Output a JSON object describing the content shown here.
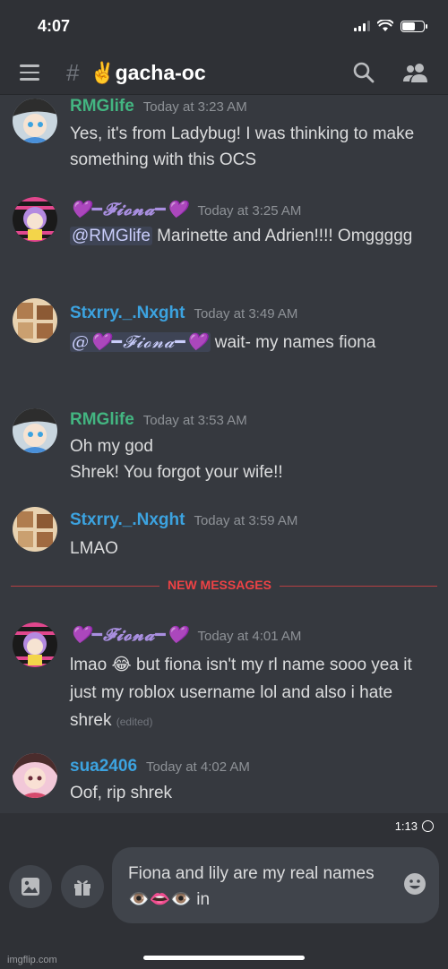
{
  "status_bar": {
    "time": "4:07"
  },
  "header": {
    "hash": "#",
    "channel": "✌️gacha-oc"
  },
  "messages": [
    {
      "author": "RMGlife",
      "author_color": "#43b581",
      "time": "Today at 3:23 AM",
      "text": "Yes, it's from Ladybug! I was thinking to make something with this OCS"
    },
    {
      "author": "💜━𝓕𝓲𝓸𝓷𝓪━💜",
      "time": "Today at 3:25 AM",
      "mention": "@RMGlife",
      "text": " Marinette and Adrien!!!! Omggggg"
    },
    {
      "author": "Stxrry._.Nxght",
      "author_color": "#3ca3e0",
      "time": "Today at 3:49 AM",
      "mention": "@💜━𝓕𝓲𝓸𝓷𝓪━💜",
      "text": " wait- my names fiona"
    },
    {
      "author": "RMGlife",
      "author_color": "#43b581",
      "time": "Today at 3:53 AM",
      "line1": "Oh my god",
      "line2": "Shrek! You forgot your wife!!"
    },
    {
      "author": "Stxrry._.Nxght",
      "author_color": "#3ca3e0",
      "time": "Today at 3:59 AM",
      "text": "LMAO"
    },
    {
      "author": "💜━𝓕𝓲𝓸𝓷𝓪━💜",
      "time": "Today at 4:01 AM",
      "text": "lmao 😂 but fiona isn't my rl name sooo yea it just my roblox username lol and also i hate shrek ",
      "edited": "(edited)"
    },
    {
      "author": "sua2406",
      "author_color": "#3ca3e0",
      "time": "Today at 4:02 AM",
      "text": "Oof, rip shrek"
    }
  ],
  "divider": {
    "label": "NEW MESSAGES"
  },
  "timer": {
    "value": "1:13"
  },
  "composer": {
    "text": "Fiona and lily are my real names 👁️👄👁️ in"
  },
  "watermark": "imgflip.com"
}
